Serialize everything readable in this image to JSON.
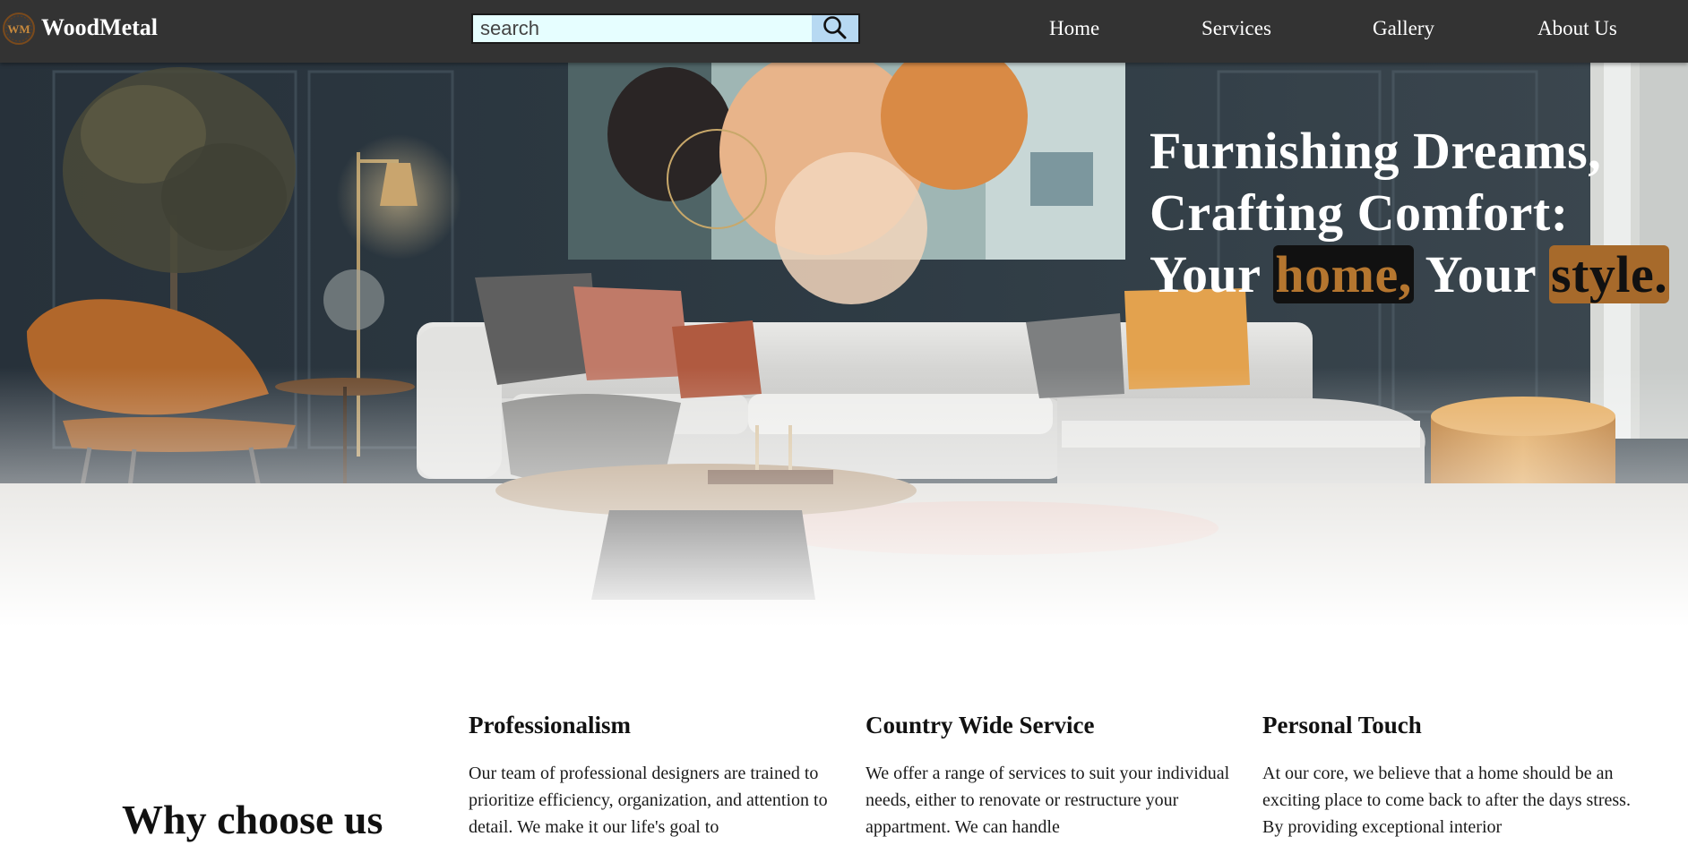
{
  "brand": {
    "logo_text": "WM",
    "name": "WoodMetal"
  },
  "search": {
    "placeholder": "search",
    "button_icon": "search-icon"
  },
  "nav": {
    "items": [
      {
        "label": "Home"
      },
      {
        "label": "Services"
      },
      {
        "label": "Gallery"
      },
      {
        "label": "About Us"
      }
    ]
  },
  "hero": {
    "line1": "Furnishing Dreams,",
    "line2": "Crafting Comfort:",
    "line3_part1": "Your",
    "highlight1": "home,",
    "line3_part2": "Your",
    "highlight2": "style.",
    "colors": {
      "highlight1_bg": "#111111",
      "highlight1_text": "#b5762f",
      "highlight2_bg": "#a76a2b",
      "highlight2_text": "#111111"
    }
  },
  "why": {
    "title": "Why choose us",
    "features": [
      {
        "title": "Professionalism",
        "text": "Our team of professional designers are trained to prioritize efficiency, organization, and attention to detail. We make it our life's goal to"
      },
      {
        "title": "Country Wide Service",
        "text": "We offer a range of services to suit your individual needs, either to renovate or restructure your appartment. We can handle"
      },
      {
        "title": "Personal Touch",
        "text": "At our core, we believe that a home should be an exciting place to come back to after the days stress. By providing exceptional interior"
      }
    ]
  },
  "colors": {
    "navbar_bg": "#333333",
    "search_bg": "#e6feff",
    "search_button_bg": "#b7d9f2",
    "accent_orange": "#b5762f"
  }
}
